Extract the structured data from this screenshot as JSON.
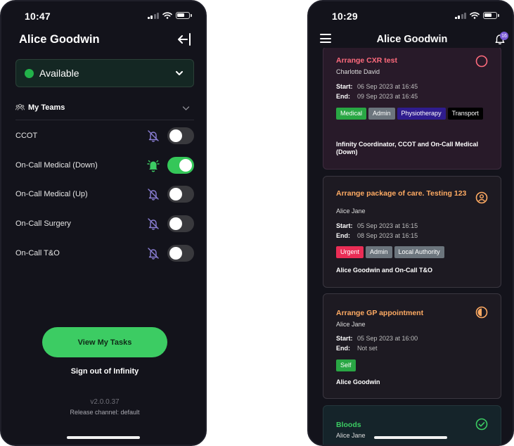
{
  "left": {
    "status_time": "10:47",
    "title": "Alice Goodwin",
    "availability": {
      "label": "Available",
      "color": "#22b24a"
    },
    "teams_label": "My Teams",
    "teams": [
      {
        "name": "CCOT",
        "enabled": false
      },
      {
        "name": "On-Call Medical (Down)",
        "enabled": true
      },
      {
        "name": "On-Call Medical (Up)",
        "enabled": false
      },
      {
        "name": "On-Call Surgery",
        "enabled": false
      },
      {
        "name": "On-Call T&O",
        "enabled": false
      }
    ],
    "view_tasks_label": "View My Tasks",
    "sign_out_label": "Sign out of Infinity",
    "version": "v2.0.0.37",
    "release_channel": "Release channel: default"
  },
  "right": {
    "status_time": "10:29",
    "title": "Alice Goodwin",
    "notification_count": "16",
    "labels": {
      "start": "Start:",
      "end": "End:"
    },
    "tasks": [
      {
        "title": "Arrange CXR test",
        "title_color": "#ff6b7d",
        "person": "Charlotte David",
        "start": "06 Sep 2023 at 16:45",
        "end": "09 Sep 2023 at 16:45",
        "tags": [
          "Medical",
          "Admin",
          "Physiotherapy",
          "Transport"
        ],
        "assignees": "Infinity Coordinator, CCOT and On-Call Medical (Down)",
        "status_icon": "empty-circle-icon"
      },
      {
        "title": "Arrange package of care.  Testing 123",
        "title_color": "#ffab63",
        "person": "Alice Jane",
        "start": "05 Sep 2023 at 16:15",
        "end": "08 Sep 2023 at 16:15",
        "tags": [
          "Urgent",
          "Admin",
          "Local Authority"
        ],
        "assignees": "Alice Goodwin and On-Call T&O",
        "status_icon": "user-circle-icon"
      },
      {
        "title": "Arrange GP appointment",
        "title_color": "#ffab63",
        "person": "Alice Jane",
        "start": "05 Sep 2023 at 16:00",
        "end": "Not set",
        "tags": [
          "Self"
        ],
        "assignees": "Alice Goodwin",
        "status_icon": "half-circle-icon"
      },
      {
        "title": "Bloods",
        "title_color": "#3ccc63",
        "person": "Alice Jane",
        "status_icon": "check-circle-icon"
      }
    ]
  }
}
